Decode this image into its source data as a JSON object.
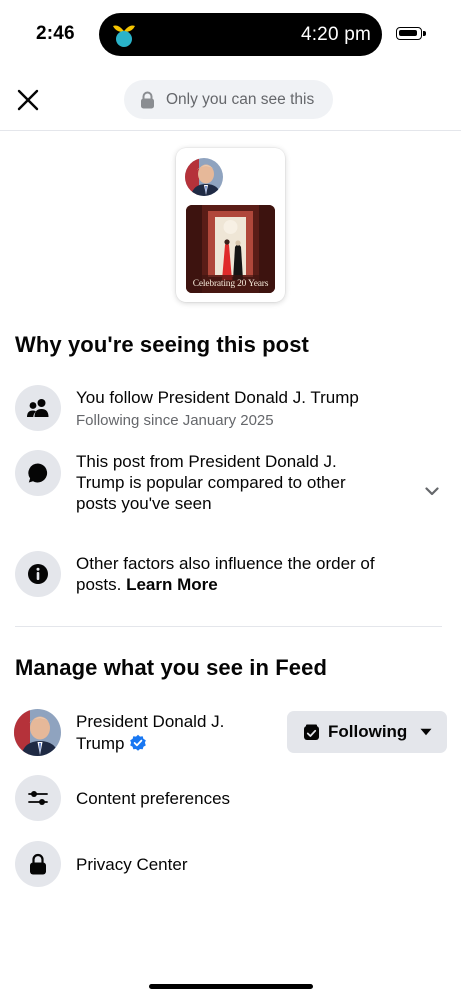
{
  "status_bar": {
    "time": "2:46",
    "island_time": "4:20 pm"
  },
  "header": {
    "privacy_label": "Only you can see this"
  },
  "post_preview": {
    "caption": "Celebrating 20 Years"
  },
  "why_section": {
    "title": "Why you're seeing this post",
    "reasons": [
      {
        "icon": "people-icon",
        "text": "You follow President Donald J. Trump",
        "subtext": "Following since January 2025"
      },
      {
        "icon": "comment-bubble-icon",
        "text_lines": [
          "This post from President Donald J.",
          "Trump is popular compared to other",
          "posts you've seen"
        ]
      },
      {
        "icon": "info-icon",
        "text_lines": [
          "Other factors also influence the order of"
        ],
        "text_tail": "posts. ",
        "link": "Learn More"
      }
    ]
  },
  "manage_section": {
    "title": "Manage what you see in Feed",
    "profile_name_lines": [
      "President Donald J.",
      "Trump"
    ],
    "following_button": "Following",
    "items": [
      {
        "icon": "sliders-icon",
        "label": "Content preferences"
      },
      {
        "icon": "lock-icon",
        "label": "Privacy Center"
      }
    ]
  },
  "colors": {
    "icon_bg": "#e4e6eb",
    "verified_blue": "#1877f2",
    "secondary_text": "#65676b"
  }
}
